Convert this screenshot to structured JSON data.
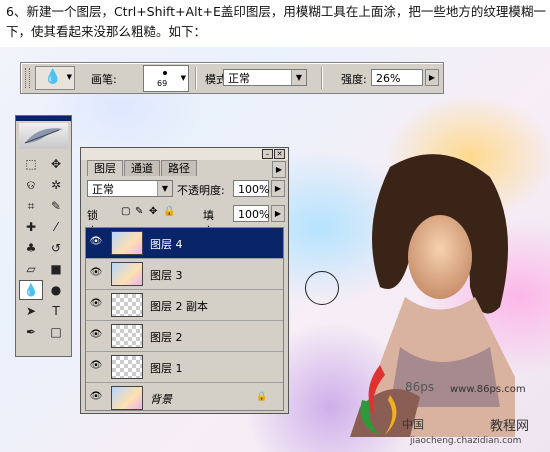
{
  "caption": "6、新建一个图层，Ctrl+Shift+Alt+E盖印图层，用模糊工具在上面涂，把一些地方的纹理模糊一下，使其看起来没那么粗糙。如下：",
  "options_bar": {
    "brush_label": "画笔:",
    "brush_size": "69",
    "mode_label": "模式:",
    "mode_value": "正常",
    "strength_label": "强度:",
    "strength_value": "26%"
  },
  "layers_panel": {
    "tabs": [
      "图层",
      "通道",
      "路径"
    ],
    "blend_mode": "正常",
    "opacity_label": "不透明度:",
    "opacity_value": "100%",
    "lock_label": "锁定:",
    "fill_label": "填充:",
    "fill_value": "100%",
    "layers": [
      {
        "name": "图层 4",
        "selected": true
      },
      {
        "name": "图层 3",
        "selected": false
      },
      {
        "name": "图层 2 副本",
        "selected": false
      },
      {
        "name": "图层 2",
        "selected": false
      },
      {
        "name": "图层 1",
        "selected": false
      },
      {
        "name": "背景",
        "selected": false
      }
    ]
  },
  "watermark": {
    "site_top": "www.86ps.com",
    "site_brand": "86ps",
    "cn_left": "中国",
    "cn_right": "教程网",
    "bottom": "jiaocheng.chazidian.com"
  }
}
